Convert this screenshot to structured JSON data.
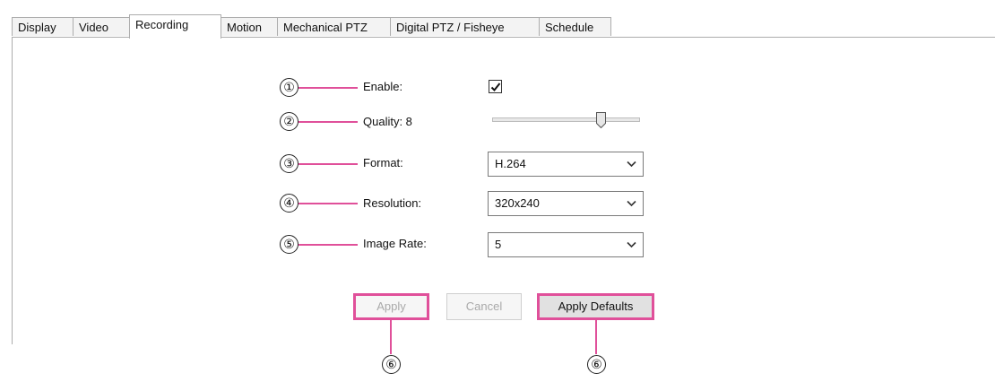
{
  "tabs": [
    {
      "label": "Display"
    },
    {
      "label": "Video"
    },
    {
      "label": "Recording",
      "active": true
    },
    {
      "label": "Motion"
    },
    {
      "label": "Mechanical PTZ"
    },
    {
      "label": "Digital PTZ / Fisheye"
    },
    {
      "label": "Schedule"
    }
  ],
  "callouts": [
    "①",
    "②",
    "③",
    "④",
    "⑤",
    "⑥",
    "⑥"
  ],
  "fields": {
    "enable": {
      "label": "Enable:",
      "checked": true
    },
    "quality": {
      "label": "Quality: 8",
      "value": 8,
      "min": 1,
      "max": 10
    },
    "format": {
      "label": "Format:",
      "value": "H.264"
    },
    "resolution": {
      "label": "Resolution:",
      "value": "320x240"
    },
    "image_rate": {
      "label": "Image Rate:",
      "value": "5"
    }
  },
  "buttons": {
    "apply": "Apply",
    "cancel": "Cancel",
    "apply_defaults": "Apply Defaults"
  },
  "colors": {
    "callout_line": "#e0509a"
  },
  "icons": {
    "checkbox": "checkmark-icon",
    "dropdown": "chevron-down-icon",
    "slider": "slider-thumb-icon"
  }
}
